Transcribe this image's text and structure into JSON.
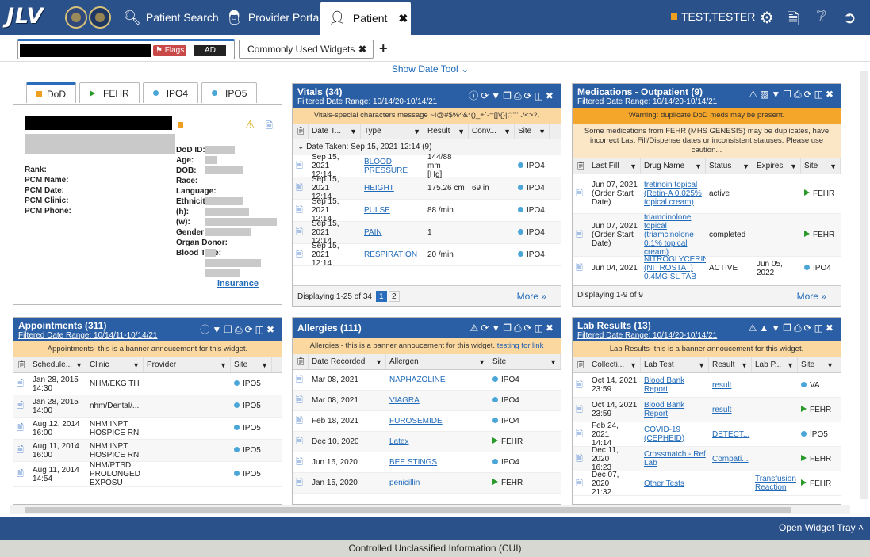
{
  "header": {
    "logo": "JLV",
    "nav": [
      {
        "label": "Patient Search",
        "icon": "search-icon"
      },
      {
        "label": "Provider Portal",
        "icon": "provider-icon"
      }
    ],
    "patient_tab": "Patient",
    "user": "TEST,TESTER"
  },
  "subbar": {
    "flags": "Flags",
    "ad": "AD",
    "widget_tab": "Commonly Used Widgets"
  },
  "date_tool": "Show Date Tool",
  "demo": {
    "tabs": [
      "DoD",
      "FEHR",
      "IPO4",
      "IPO5"
    ],
    "left_fields": [
      "Rank:",
      "PCM Name:",
      "PCM Date:",
      "PCM Clinic:",
      "PCM Phone:"
    ],
    "right_fields": [
      "DoD ID:",
      "Age:",
      "DOB:",
      "Race:",
      "Language:",
      "Ethnicity:",
      "(h):",
      "(w):",
      "Gender:",
      "Organ Donor:",
      "Blood Type:"
    ],
    "insurance": "Insurance"
  },
  "vitals": {
    "title": "Vitals (34)",
    "range": "Filtered Date Range: 10/14/20-10/14/21",
    "banner": "Vitals-special characters message ~!@#$%^&*()_+`-=[]\\{}|;':\"\",./<>?.",
    "cols": [
      "Date T...",
      "Type",
      "Result",
      "Conv...",
      "Site"
    ],
    "group": "Date Taken: Sep 15, 2021 12:14 (9)",
    "rows": [
      [
        "Sep 15, 2021\n12:14",
        "BLOOD\nPRESSURE",
        "144/88 mm\n[Hg]",
        "",
        "IPO4"
      ],
      [
        "Sep 15, 2021\n12:14",
        "HEIGHT",
        "175.26 cm",
        "69 in",
        "IPO4"
      ],
      [
        "Sep 15, 2021\n12:14",
        "PULSE",
        "88 /min",
        "",
        "IPO4"
      ],
      [
        "Sep 15, 2021\n12:14",
        "PAIN",
        "1",
        "",
        "IPO4"
      ],
      [
        "Sep 15, 2021\n12:14",
        "RESPIRATION",
        "20 /min",
        "",
        "IPO4"
      ]
    ],
    "footer": "Displaying 1-25 of 34",
    "pages": [
      "1",
      "2"
    ],
    "more": "More"
  },
  "meds": {
    "title": "Medications - Outpatient (9)",
    "range": "Filtered Date Range: 10/14/20-10/14/21",
    "warn": "Warning: duplicate DoD meds may be present.",
    "banner2": "Some medications from FEHR (MHS GENESIS) may be duplicates, have incorrect Last Fill/Dispense dates or inconsistent statuses. Please use caution...",
    "cols": [
      "Last Fill",
      "Drug Name",
      "Status",
      "Expires",
      "Site"
    ],
    "rows": [
      [
        "Jun 07, 2021\n(Order Start\nDate)",
        "tretinoin topical\n(Retin-A 0.025%\ntopical cream)",
        "active",
        "",
        "FEHR"
      ],
      [
        "Jun 07, 2021\n(Order Start\nDate)",
        "triamcinolone\ntopical\n(triamcinolone\n0.1% topical\ncream)",
        "completed",
        "",
        "FEHR"
      ],
      [
        "Jun 04, 2021",
        "NITROGLYCERIN\n(NITROSTAT)\n0.4MG SL TAB",
        "ACTIVE",
        "Jun 05,\n2022",
        "IPO4"
      ]
    ],
    "footer": "Displaying 1-9 of 9",
    "more": "More"
  },
  "appts": {
    "title": "Appointments (311)",
    "range": "Filtered Date Range: 10/14/11-10/14/21",
    "banner": "Appointments- this is a banner annoucement for this widget.",
    "cols": [
      "Schedule...",
      "Clinic",
      "Provider",
      "Site"
    ],
    "rows": [
      [
        "Jan 28, 2015\n14:30",
        "NHM/EKG TH",
        "",
        "IPO5"
      ],
      [
        "Jan 28, 2015\n14:00",
        "nhm/Dental/...",
        "",
        "IPO5"
      ],
      [
        "Aug 12, 2014\n16:00",
        "NHM INPT\nHOSPICE RN",
        "",
        "IPO5"
      ],
      [
        "Aug 11, 2014\n16:00",
        "NHM INPT\nHOSPICE RN",
        "",
        "IPO5"
      ],
      [
        "Aug 11, 2014\n14:54",
        "NHM/PTSD\nPROLONGED\nEXPOSU",
        "",
        "IPO5"
      ]
    ]
  },
  "allergies": {
    "title": "Allergies (111)",
    "banner": "Allergies - this is a banner annoucement for this widget.",
    "banner_link": "testing for link",
    "cols": [
      "Date Recorded",
      "Allergen",
      "Site"
    ],
    "rows": [
      [
        "Mar 08, 2021",
        "NAPHAZOLINE",
        "IPO4"
      ],
      [
        "Mar 08, 2021",
        "VIAGRA",
        "IPO4"
      ],
      [
        "Feb 18, 2021",
        "FUROSEMIDE",
        "IPO4"
      ],
      [
        "Dec 10, 2020",
        "Latex",
        "FEHR"
      ],
      [
        "Jun 16, 2020",
        "BEE STINGS",
        "IPO4"
      ],
      [
        "Jan 15, 2020",
        "penicillin",
        "FEHR"
      ]
    ]
  },
  "labs": {
    "title": "Lab Results (13)",
    "range": "Filtered Date Range: 10/14/20-10/14/21",
    "banner": "Lab Results- this is a banner annoucement for this widget.",
    "cols": [
      "Collecti...",
      "Lab Test",
      "Result",
      "Lab P...",
      "Site"
    ],
    "rows": [
      [
        "Oct 14, 2021\n23:59",
        "Blood Bank\nReport",
        "result",
        "",
        "VA"
      ],
      [
        "Oct 14, 2021\n23:59",
        "Blood Bank\nReport",
        "result",
        "",
        "FEHR"
      ],
      [
        "Feb 24, 2021\n14:14",
        "COVID-19\n(CEPHEID)",
        "DETECT...",
        "",
        "IPO5"
      ],
      [
        "Dec 11, 2020\n16:23",
        "Crossmatch - Ref\nLab",
        "Compati...",
        "",
        "FEHR"
      ],
      [
        "Dec 07, 2020\n21:32",
        "Other Tests",
        "",
        "Transfusion\nReaction",
        "FEHR"
      ]
    ]
  },
  "tray": "Open Widget Tray",
  "cui": "Controlled Unclassified Information (CUI)"
}
